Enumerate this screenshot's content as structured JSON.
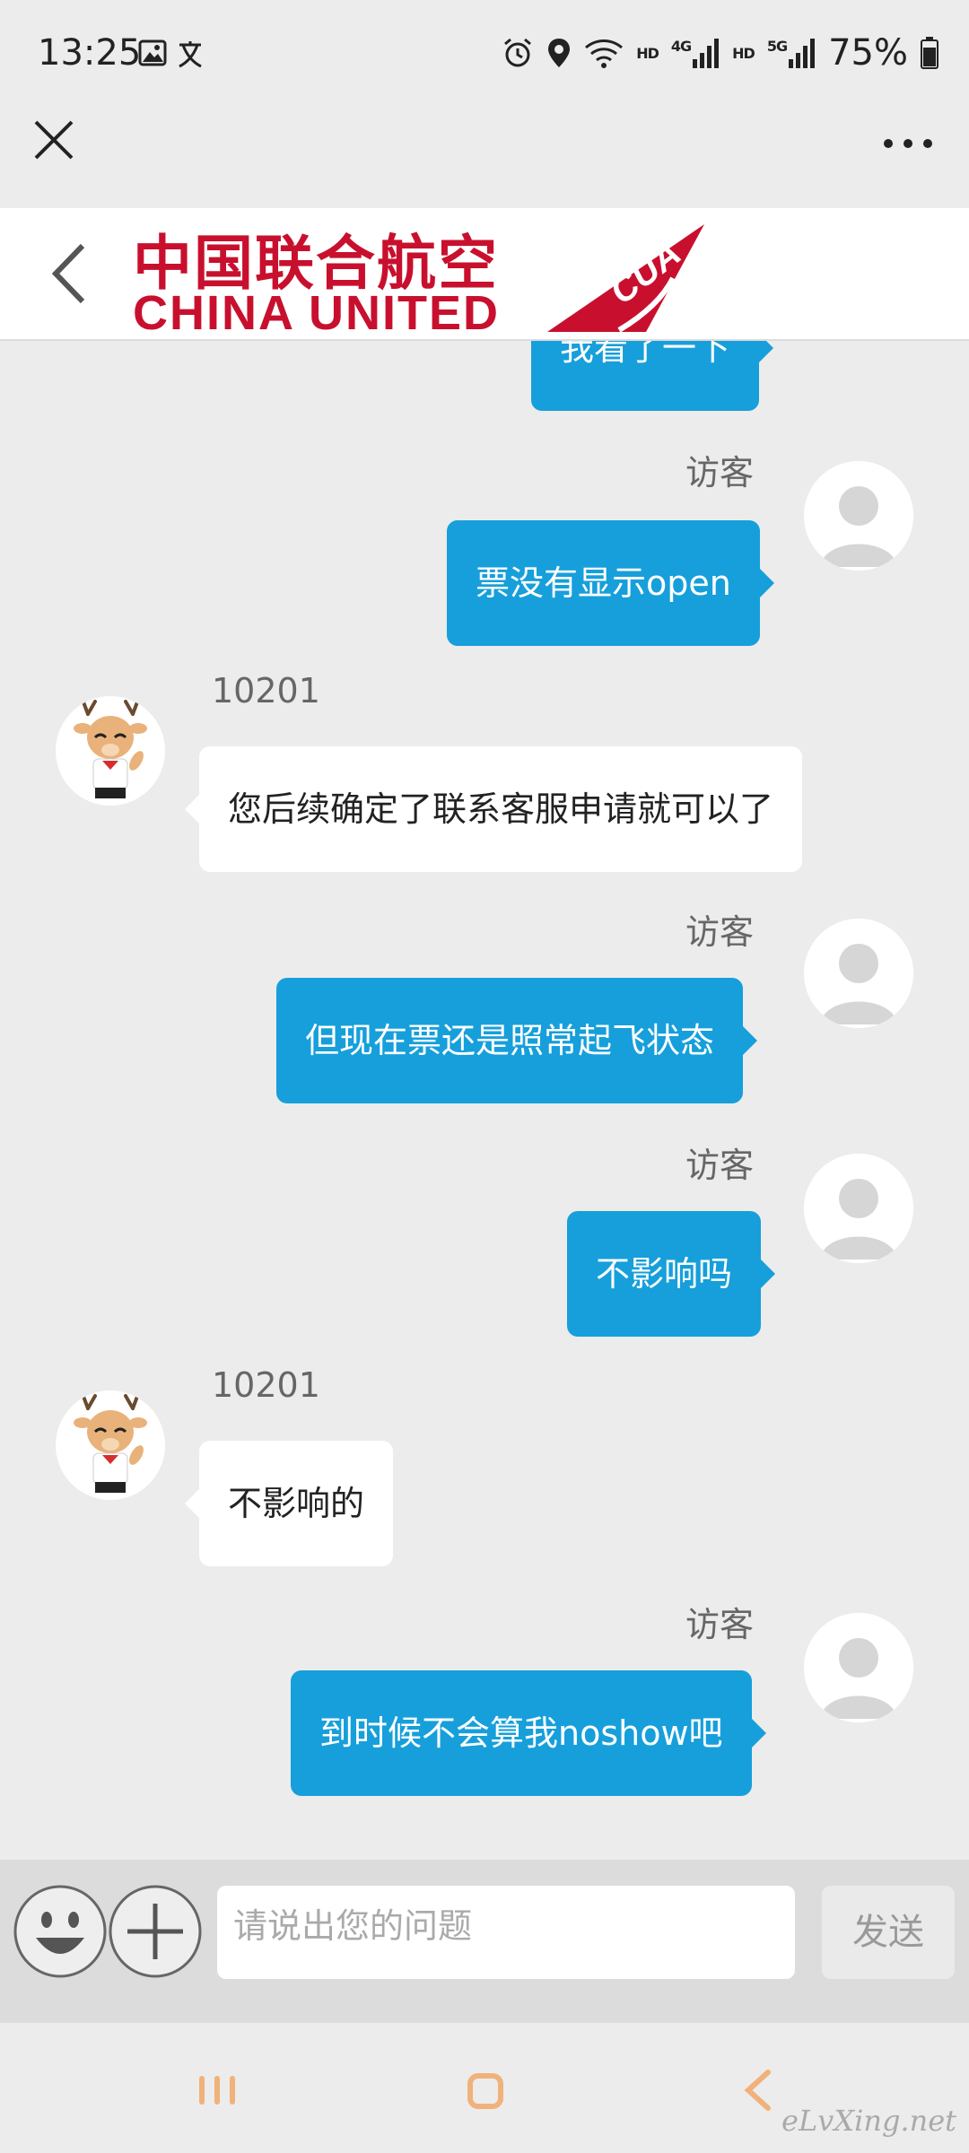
{
  "status_bar": {
    "time": "13:25",
    "battery": "75%",
    "net1": "4G",
    "net2": "5G",
    "hd": "HD"
  },
  "airline": {
    "name_cn": "中国联合航空",
    "name_en": "CHINA UNITED",
    "tail_text": "CUA"
  },
  "chat": {
    "messages": [
      {
        "role": "visitor",
        "text": "我看了一下"
      },
      {
        "role": "visitor",
        "sender": "访客",
        "text": "票没有显示open"
      },
      {
        "role": "agent",
        "sender": "10201",
        "text": "您后续确定了联系客服申请就可以了"
      },
      {
        "role": "visitor",
        "sender": "访客",
        "text": "但现在票还是照常起飞状态"
      },
      {
        "role": "visitor",
        "sender": "访客",
        "text": "不影响吗"
      },
      {
        "role": "agent",
        "sender": "10201",
        "text": "不影响的"
      },
      {
        "role": "visitor",
        "sender": "访客",
        "text": "到时候不会算我noshow吧"
      }
    ]
  },
  "input": {
    "placeholder": "请说出您的问题",
    "send_label": "发送"
  },
  "watermark": "eLvXing.net",
  "colors": {
    "visitor_bubble": "#169fdb",
    "agent_bubble": "#ffffff",
    "brand_red": "#c8102e"
  }
}
